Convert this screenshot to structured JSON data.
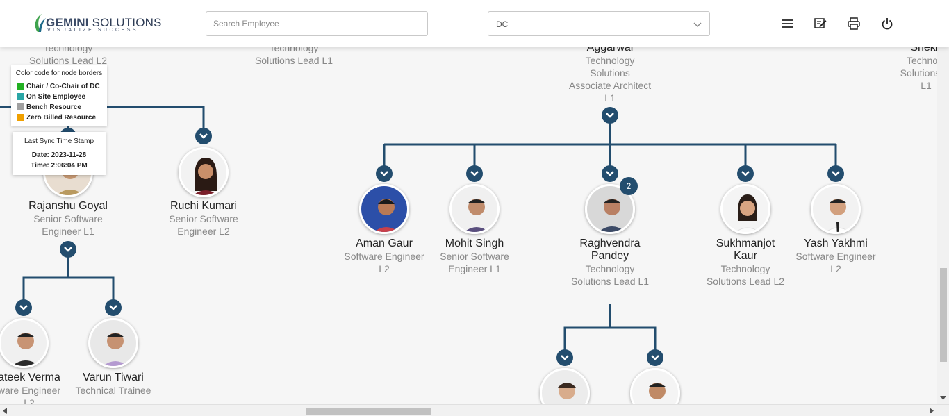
{
  "header": {
    "logo_word": "GEMINI",
    "logo_word2": "SOLUTIONS",
    "logo_tagline": "VISUALIZE SUCCESS",
    "search_placeholder": "Search Employee",
    "dropdown_value": "DC"
  },
  "icons": [
    "menu-icon",
    "edit-note-icon",
    "print-icon",
    "power-icon"
  ],
  "legend": {
    "title": "Color code for node borders",
    "items": [
      {
        "label": "Chair / Co-Chair of DC",
        "color": "#22b022"
      },
      {
        "label": "On Site Employee",
        "color": "#2aa6a6"
      },
      {
        "label": "Bench Resource",
        "color": "#a0a0a0"
      },
      {
        "label": "Zero Billed Resource",
        "color": "#f0a000"
      }
    ]
  },
  "sync": {
    "title": "Last Sync Time Stamp",
    "date": "Date: 2023-11-28",
    "time": "Time: 2:06:04 PM"
  },
  "top_partial": {
    "a": [
      "Technology",
      "Solutions Lead L2"
    ],
    "b": [
      "Technology",
      "Solutions Lead L1"
    ],
    "c": [
      "Aggarwal",
      "Technology",
      "Solutions",
      "Associate Architect",
      "L1"
    ],
    "d": [
      "Shekh",
      "Technolo",
      "Solutions Ar",
      "L1"
    ]
  },
  "nodes": {
    "rajanshu": {
      "name": "Rajanshu Goyal",
      "role": "Senior Software Engineer L1"
    },
    "ruchi": {
      "name": "Ruchi Kumari",
      "role": "Senior Software Engineer L2"
    },
    "prateek": {
      "name": "ateek Verma",
      "role": "ware Engineer",
      "role2": "L2"
    },
    "varun": {
      "name": "Varun Tiwari",
      "role": "Technical Trainee"
    },
    "aman": {
      "name": "Aman Gaur",
      "role": "Software Engineer L2"
    },
    "mohit": {
      "name": "Mohit Singh",
      "role": "Senior Software Engineer L1"
    },
    "raghvendra": {
      "name": "Raghvendra Pandey",
      "role": "Technology Solutions Lead L1",
      "badge": "2"
    },
    "sukhmanjot": {
      "name": "Sukhmanjot Kaur",
      "role": "Technology Solutions Lead L2"
    },
    "yash": {
      "name": "Yash Yakhmi",
      "role": "Software Engineer L2"
    }
  }
}
